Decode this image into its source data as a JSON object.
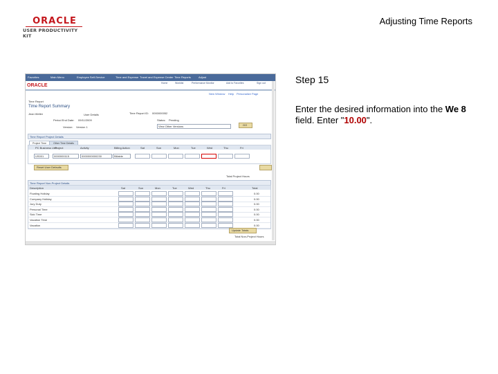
{
  "header": {
    "logo_word": "ORACLE",
    "logo_sub": "USER PRODUCTIVITY KIT",
    "doc_title": "Adjusting Time Reports"
  },
  "screenshot": {
    "menu_items": [
      "Favorites",
      "Main Menu",
      "Employee Self-Service",
      "Time and Expense",
      "Travel and Expense Center",
      "Time Reports",
      "Adjust"
    ],
    "brand": "ORACLE",
    "top_links": [
      "Home",
      "Worklist",
      "Performance Monitor",
      "Add to Favorites",
      "Sign out"
    ],
    "nav_links": [
      "New Window",
      "Help",
      "Personalize Page",
      "http"
    ],
    "breadcrumb": "Time Report",
    "page_title": "Time Report Summary",
    "user_name": "Jean Weller",
    "labels": {
      "user_details": "User Details",
      "report_id_label": "Time Report ID:",
      "report_id": "0000000052",
      "period_end_label": "Period End Date:",
      "period_end": "09/11/2009",
      "status_label": "Status:",
      "status": "Pending",
      "version_label": "Version:",
      "version": "Version 1",
      "view_select": "View Other Versions",
      "go": "GO",
      "section_project": "Time Report Project Details",
      "tab_project": "Project Time",
      "tab_other": "Other Time Details",
      "user_defaults": "Reset User Defaults",
      "total_project_hours": "Total Project Hours",
      "section_nonproject": "Time Report Non-Project Details",
      "update_totals": "Update Totals",
      "total_nonproject_hours": "Total Non-Project Hours"
    },
    "project_columns": [
      "PC Business Unit",
      "Project",
      "Activity",
      "Billing Action",
      "Sat",
      "Sun",
      "Mon",
      "Tue",
      "Wed",
      "Thu",
      "Fri"
    ],
    "project_row": [
      "US001",
      "0000000115",
      "0000000000230",
      "Billable"
    ],
    "nonproject_columns": [
      "Description",
      "Sat",
      "Sun",
      "Mon",
      "Tue",
      "Wed",
      "Thu",
      "Fri",
      "Total"
    ],
    "nonproject_rows": [
      {
        "desc": "Floating Holiday",
        "total": "0.00"
      },
      {
        "desc": "Company Holiday",
        "total": "0.00"
      },
      {
        "desc": "Jury Duty",
        "total": "0.00"
      },
      {
        "desc": "Personal Time",
        "total": "0.00"
      },
      {
        "desc": "Sick Time",
        "total": "0.00"
      },
      {
        "desc": "Vacation Time",
        "total": "0.00"
      },
      {
        "desc": "Vacation",
        "total": "0.00"
      }
    ]
  },
  "step": {
    "title": "Step 15",
    "text_1": "Enter the desired information into the ",
    "field": "We 8",
    "text_2": " field. Enter \"",
    "value": "10.00",
    "text_3": "\"."
  }
}
